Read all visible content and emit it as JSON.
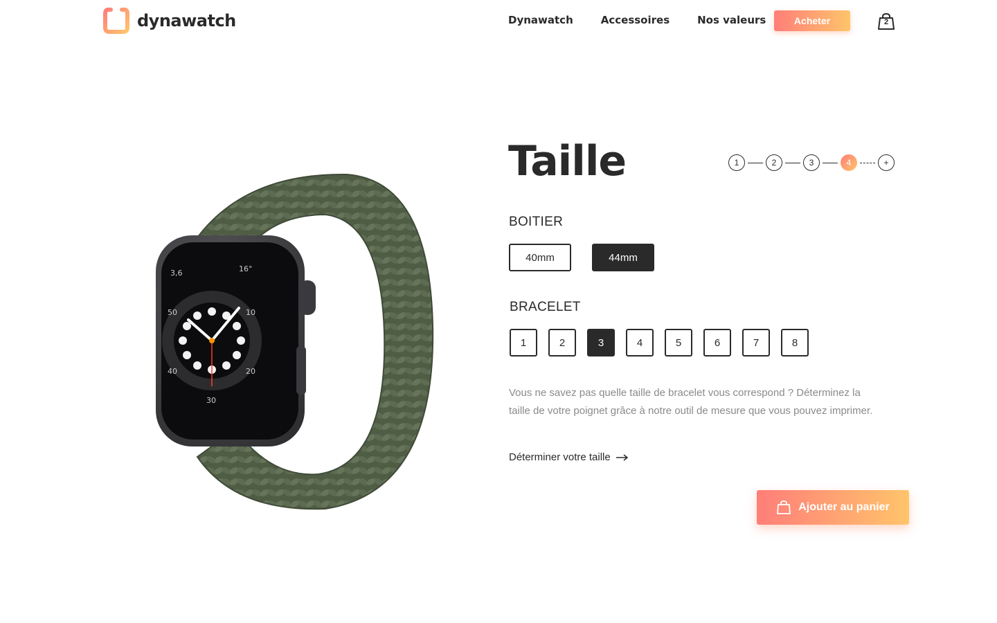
{
  "brand": {
    "name": "dynawatch"
  },
  "nav": {
    "links": [
      "Dynawatch",
      "Accessoires",
      "Nos valeurs"
    ],
    "buy_label": "Acheter",
    "cart_count": "2"
  },
  "product": {
    "title": "Taille",
    "steps": [
      "1",
      "2",
      "3",
      "4",
      "+"
    ],
    "active_step": "4"
  },
  "case": {
    "label": "BOITIER",
    "options": [
      "40mm",
      "44mm"
    ],
    "selected": "44mm"
  },
  "band": {
    "label": "BRACELET",
    "options": [
      "1",
      "2",
      "3",
      "4",
      "5",
      "6",
      "7",
      "8"
    ],
    "selected": "3"
  },
  "help": {
    "text": "Vous ne savez pas quelle taille de bracelet vous correspond ? Déterminez la taille de votre poignet grâce à notre outil de mesure que vous pouvez imprimer.",
    "link": "Déterminer votre taille"
  },
  "cta": {
    "label": "Ajouter au panier"
  },
  "colors": {
    "accent_start": "#ff7e79",
    "accent_end": "#ffc46b",
    "dark": "#2a2a2a",
    "band_green": "#55634a"
  }
}
